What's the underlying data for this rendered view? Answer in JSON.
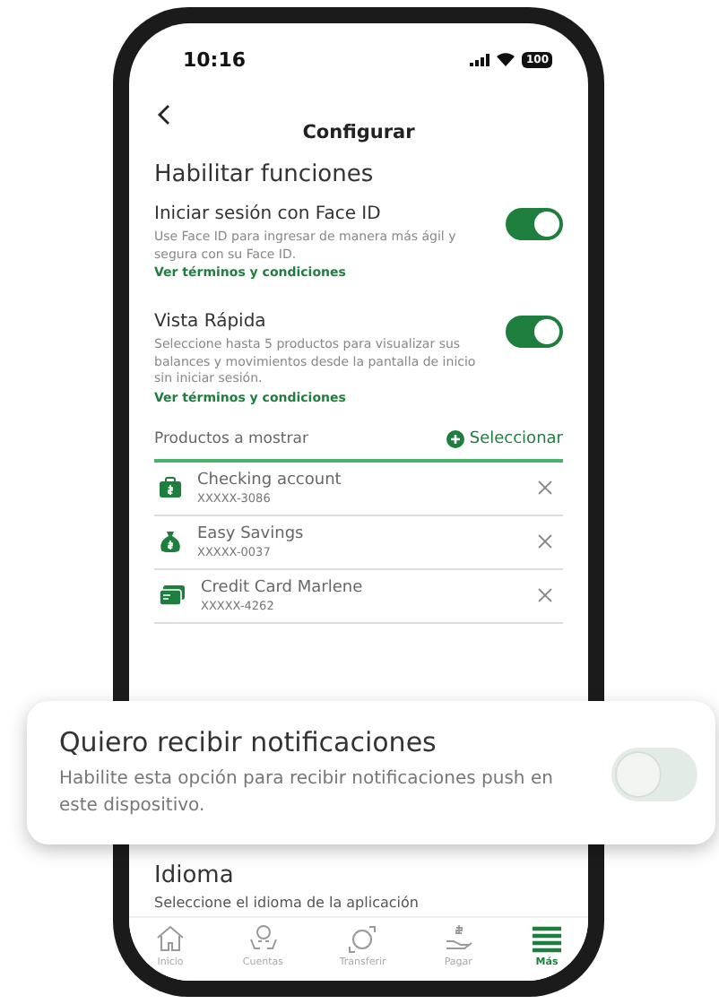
{
  "status_bar": {
    "time": "10:16",
    "battery": "100"
  },
  "header": {
    "title": "Configurar"
  },
  "section_title": "Habilitar funciones",
  "settings": [
    {
      "title": "Iniciar sesión con Face ID",
      "description": "Use Face ID para ingresar de manera más ágil y segura con su Face ID.",
      "link": "Ver términos y condiciones",
      "on": true
    },
    {
      "title": "Vista Rápida",
      "description": "Seleccione hasta 5 productos para visualizar sus balances y movimientos desde la pantalla de inicio sin iniciar sesión.",
      "link": "Ver términos y condiciones",
      "on": true
    }
  ],
  "products_header": {
    "label": "Productos a mostrar",
    "action": "Seleccionar"
  },
  "products": [
    {
      "kind": "wallet",
      "name": "Checking account",
      "number": "XXXXX-3086"
    },
    {
      "kind": "moneybag",
      "name": "Easy Savings",
      "number": "XXXXX-0037"
    },
    {
      "kind": "card",
      "name": "Credit Card Marlene",
      "number": "XXXXX-4262"
    }
  ],
  "notification_card": {
    "title": "Quiero recibir notificaciones",
    "description": "Habilite esta opción para recibir notificaciones push en este dispositivo.",
    "on": false
  },
  "language": {
    "title": "Idioma",
    "subtitle": "Seleccione el idioma de la aplicación"
  },
  "tab_bar": [
    {
      "kind": "home",
      "label": "Inicio",
      "selected": false
    },
    {
      "kind": "accounts",
      "label": "Cuentas",
      "selected": false
    },
    {
      "kind": "transfer",
      "label": "Transferir",
      "selected": false
    },
    {
      "kind": "pay",
      "label": "Pagar",
      "selected": false
    },
    {
      "kind": "more",
      "label": "Más",
      "selected": true
    }
  ]
}
